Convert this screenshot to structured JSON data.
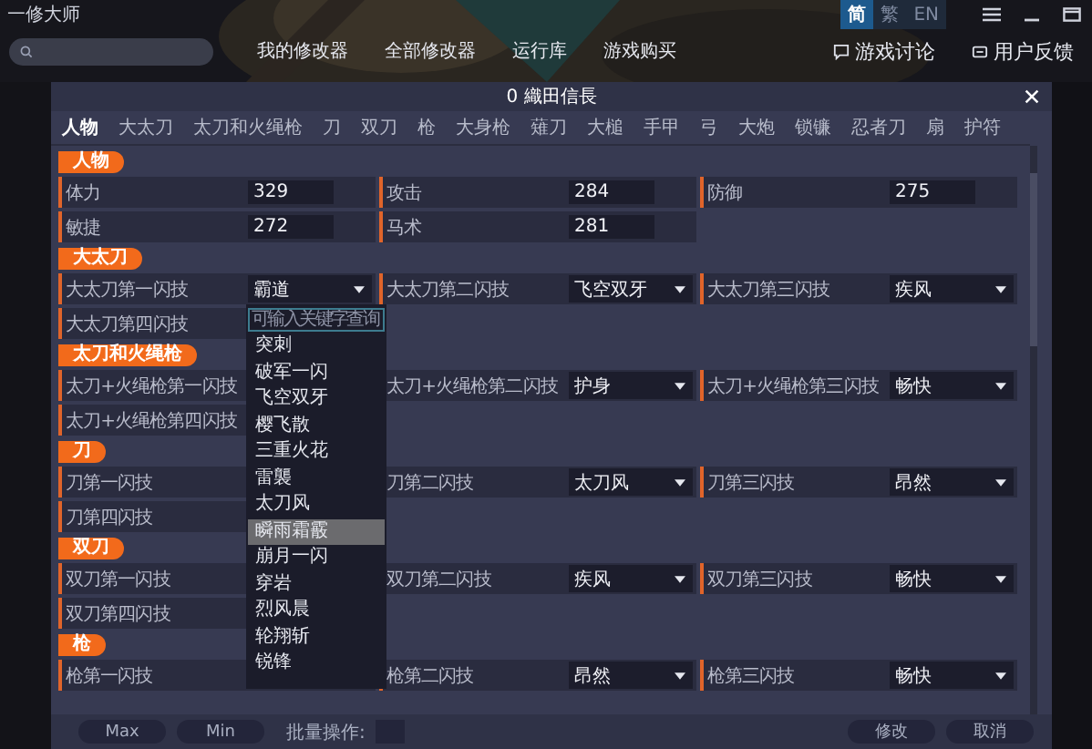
{
  "app": {
    "title": "一修大师",
    "nav": [
      "我的修改器",
      "全部修改器",
      "运行库",
      "游戏购买"
    ],
    "languages": [
      {
        "label": "简",
        "selected": true
      },
      {
        "label": "繁",
        "selected": false
      },
      {
        "label": "EN",
        "selected": false
      }
    ],
    "links": [
      {
        "kind": "discuss",
        "label": "游戏讨论"
      },
      {
        "kind": "feedback",
        "label": "用户反馈"
      }
    ]
  },
  "dialog": {
    "title": "0 織田信長",
    "tabs": [
      {
        "label": "人物",
        "selected": true
      },
      {
        "label": "大太刀",
        "selected": false
      },
      {
        "label": "太刀和火绳枪",
        "selected": false
      },
      {
        "label": "刀",
        "selected": false
      },
      {
        "label": "双刀",
        "selected": false
      },
      {
        "label": "枪",
        "selected": false
      },
      {
        "label": "大身枪",
        "selected": false
      },
      {
        "label": "薙刀",
        "selected": false
      },
      {
        "label": "大槌",
        "selected": false
      },
      {
        "label": "手甲",
        "selected": false
      },
      {
        "label": "弓",
        "selected": false
      },
      {
        "label": "大炮",
        "selected": false
      },
      {
        "label": "锁镰",
        "selected": false
      },
      {
        "label": "忍者刀",
        "selected": false
      },
      {
        "label": "扇",
        "selected": false
      },
      {
        "label": "护符",
        "selected": false
      }
    ],
    "sections": [
      {
        "title": "人物",
        "items": [
          {
            "kind": "number",
            "label": "体力",
            "value": "329"
          },
          {
            "kind": "number",
            "label": "攻击",
            "value": "284"
          },
          {
            "kind": "number",
            "label": "防御",
            "value": "275"
          },
          {
            "kind": "number",
            "label": "敏捷",
            "value": "272"
          },
          {
            "kind": "number",
            "label": "马术",
            "value": "281"
          }
        ]
      },
      {
        "title": "大太刀",
        "items": [
          {
            "kind": "select",
            "label": "大太刀第一闪技",
            "value": "霸道",
            "dropdown": {
              "placeholder": "可输入关键字查询",
              "options": [
                {
                  "label": "突刺",
                  "selected": false
                },
                {
                  "label": "破军一闪",
                  "selected": false
                },
                {
                  "label": "飞空双牙",
                  "selected": false
                },
                {
                  "label": "樱飞散",
                  "selected": false
                },
                {
                  "label": "三重火花",
                  "selected": false
                },
                {
                  "label": "雷襲",
                  "selected": false
                },
                {
                  "label": "太刀风",
                  "selected": false
                },
                {
                  "label": "瞬雨霜霰",
                  "selected": true
                },
                {
                  "label": "崩月一闪",
                  "selected": false
                },
                {
                  "label": "穿岩",
                  "selected": false
                },
                {
                  "label": "烈风晨",
                  "selected": false
                },
                {
                  "label": "轮翔斩",
                  "selected": false
                },
                {
                  "label": "锐锋",
                  "selected": false
                }
              ]
            }
          },
          {
            "kind": "select",
            "label": "大太刀第二闪技",
            "value": "飞空双牙"
          },
          {
            "kind": "select",
            "label": "大太刀第三闪技",
            "value": "疾风"
          },
          {
            "kind": "select",
            "label": "大太刀第四闪技"
          }
        ]
      },
      {
        "title": "太刀和火绳枪",
        "items": [
          {
            "kind": "select",
            "label": "太刀+火绳枪第一闪技"
          },
          {
            "kind": "select",
            "label": "太刀+火绳枪第二闪技",
            "value": "护身"
          },
          {
            "kind": "select",
            "label": "太刀+火绳枪第三闪技",
            "value": "畅快"
          },
          {
            "kind": "select",
            "label": "太刀+火绳枪第四闪技"
          }
        ]
      },
      {
        "title": "刀",
        "items": [
          {
            "kind": "select",
            "label": "刀第一闪技"
          },
          {
            "kind": "select",
            "label": "刀第二闪技",
            "value": "太刀风"
          },
          {
            "kind": "select",
            "label": "刀第三闪技",
            "value": "昂然"
          },
          {
            "kind": "select",
            "label": "刀第四闪技"
          }
        ]
      },
      {
        "title": "双刀",
        "items": [
          {
            "kind": "select",
            "label": "双刀第一闪技"
          },
          {
            "kind": "select",
            "label": "双刀第二闪技",
            "value": "疾风"
          },
          {
            "kind": "select",
            "label": "双刀第三闪技",
            "value": "畅快"
          },
          {
            "kind": "select",
            "label": "双刀第四闪技"
          }
        ]
      },
      {
        "title": "枪",
        "items": [
          {
            "kind": "select",
            "label": "枪第一闪技"
          },
          {
            "kind": "select",
            "label": "枪第二闪技",
            "value": "昂然"
          },
          {
            "kind": "select",
            "label": "枪第三闪技",
            "value": "畅快"
          }
        ]
      }
    ],
    "footer": {
      "left_buttons": [
        "Max",
        "Min"
      ],
      "batch_label": "批量操作:",
      "right_buttons": [
        "修改",
        "取消"
      ]
    }
  }
}
